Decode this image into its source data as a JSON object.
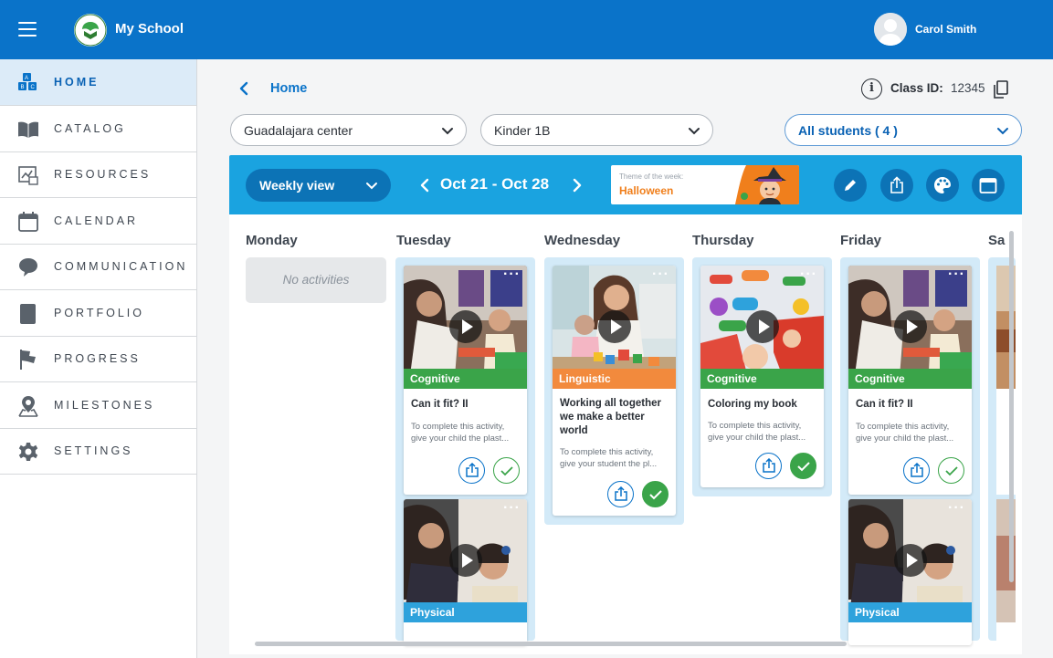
{
  "app": {
    "title": "My School",
    "user_name": "Carol Smith"
  },
  "sidebar": {
    "items": [
      {
        "label": "HOME",
        "icon": "abc-blocks-icon",
        "active": true
      },
      {
        "label": "CATALOG",
        "icon": "book-icon"
      },
      {
        "label": "RESOURCES",
        "icon": "resources-icon"
      },
      {
        "label": "CALENDAR",
        "icon": "calendar-icon"
      },
      {
        "label": "COMMUNICATION",
        "icon": "chat-bubble-icon"
      },
      {
        "label": "PORTFOLIO",
        "icon": "portfolio-icon"
      },
      {
        "label": "PROGRESS",
        "icon": "flag-icon"
      },
      {
        "label": "MILESTONES",
        "icon": "map-pin-icon"
      },
      {
        "label": "SETTINGS",
        "icon": "gear-icon"
      }
    ]
  },
  "header": {
    "breadcrumb": "Home",
    "class_id_label": "Class ID:",
    "class_id_value": "12345"
  },
  "filters": {
    "center": "Guadalajara center",
    "group": "Kinder 1B",
    "students": "All students ( 4 )"
  },
  "toolbar": {
    "view": "Weekly view",
    "week_range": "Oct 21 - Oct 28",
    "theme_caption": "Theme of the week:",
    "theme_name": "Halloween",
    "actions": [
      "pencil-icon",
      "share-icon",
      "palette-icon",
      "calendar-icon"
    ]
  },
  "calendar": {
    "days": [
      "Monday",
      "Tuesday",
      "Wednesday",
      "Thursday",
      "Friday",
      "Sa"
    ],
    "no_activities": "No activities",
    "cards": {
      "tue1": {
        "category": "Cognitive",
        "title": "Can it fit? II",
        "desc": "To complete this activity, give your child the plast...",
        "done": false
      },
      "tue2": {
        "category": "Physical"
      },
      "wed1": {
        "category": "Linguistic",
        "title": "Working all together we make a better world",
        "desc": "To complete this activity, give your student the pl...",
        "done": true
      },
      "thu1": {
        "category": "Cognitive",
        "title": "Coloring my book",
        "desc": "To complete this activity, give your child the plast...",
        "done": true
      },
      "fri1": {
        "category": "Cognitive",
        "title": "Can it fit? II",
        "desc": "To complete this activity, give your child the plast...",
        "done": false
      },
      "fri2": {
        "category": "Physical"
      }
    }
  },
  "colors": {
    "brand_blue": "#0a73c9",
    "toolbar_blue": "#1aa3e0",
    "cognitive_green": "#3aa449",
    "linguistic_orange": "#f28a3d",
    "physical_blue": "#2ea2dc"
  }
}
